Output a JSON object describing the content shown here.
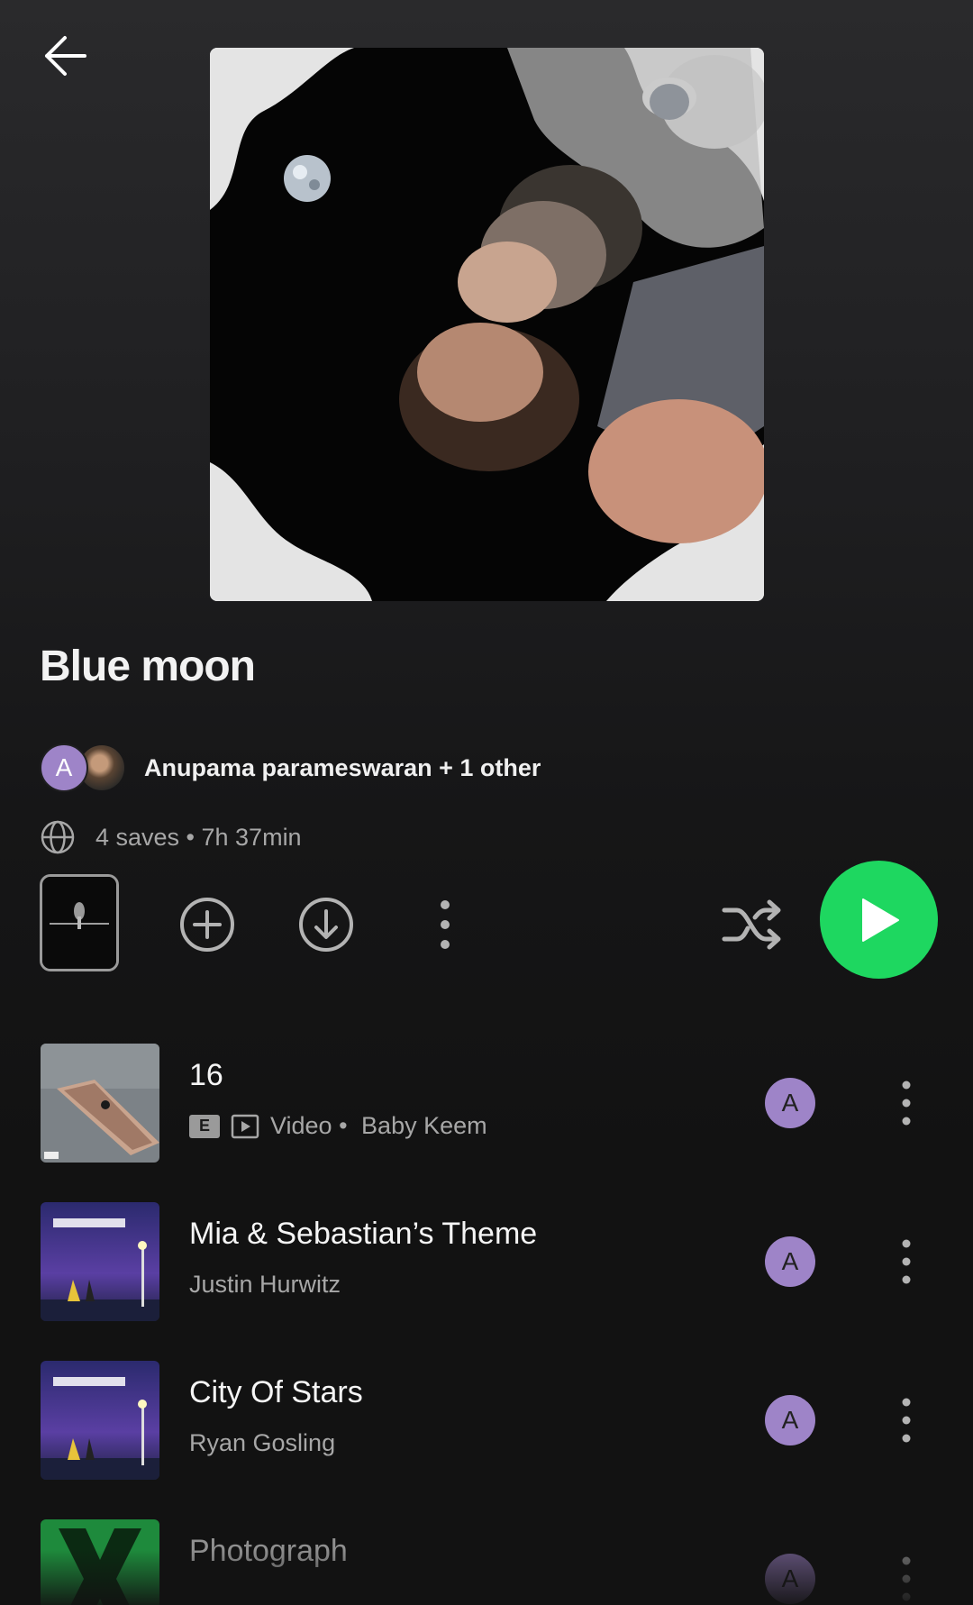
{
  "playlist": {
    "title": "Blue moon",
    "owners_text": "Anupama parameswaran + 1 other",
    "owner_avatar_letter": "A",
    "meta": "4 saves • 7h 37min"
  },
  "icons": {
    "back": "arrow-left-icon",
    "globe": "globe-icon",
    "add": "plus-circle-icon",
    "download": "download-icon",
    "more": "more-vertical-icon",
    "shuffle": "shuffle-icon",
    "play": "play-icon"
  },
  "colors": {
    "accent": "#1ed760",
    "avatar": "#9e84c8",
    "secondary_text": "#a7a7a7"
  },
  "tracks": [
    {
      "title": "16",
      "explicit": "E",
      "type": "Video",
      "separator": " • ",
      "artist": "Baby Keem",
      "added_by": "A"
    },
    {
      "title": "Mia & Sebastian’s Theme",
      "artist": "Justin Hurwitz",
      "added_by": "A"
    },
    {
      "title": "City Of Stars",
      "artist": "Ryan Gosling",
      "added_by": "A"
    },
    {
      "title": "Photograph",
      "added_by": "A"
    }
  ]
}
